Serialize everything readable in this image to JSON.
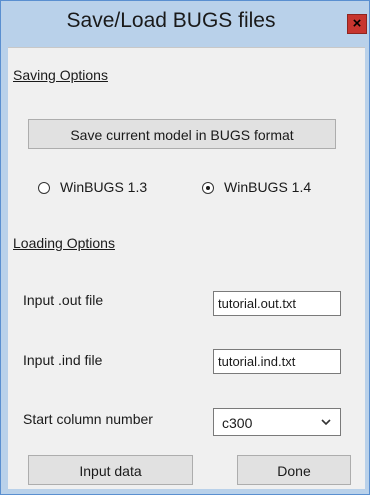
{
  "window": {
    "title": "Save/Load BUGS files",
    "close_glyph": "×"
  },
  "saving": {
    "section_label": "Saving Options",
    "save_button_label": "Save current model in BUGS format",
    "radios": [
      {
        "label": "WinBUGS 1.3",
        "selected": false
      },
      {
        "label": "WinBUGS 1.4",
        "selected": true
      }
    ]
  },
  "loading": {
    "section_label": "Loading Options",
    "out_file_label": "Input .out file",
    "out_file_value": "tutorial.out.txt",
    "ind_file_label": "Input .ind file",
    "ind_file_value": "tutorial.ind.txt",
    "start_col_label": "Start column number",
    "start_col_value": "c300"
  },
  "buttons": {
    "input_data_label": "Input data",
    "done_label": "Done"
  },
  "icons": {
    "close": "close-icon",
    "dropdown": "chevron-down-icon"
  },
  "colors": {
    "window_frame": "#b9d1ea",
    "client_bg": "#f0f0f0",
    "close_button": "#c7352f"
  }
}
